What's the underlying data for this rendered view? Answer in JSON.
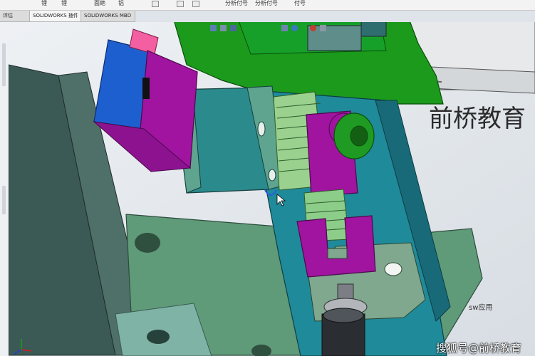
{
  "ribbon": {
    "labels": [
      "锂",
      "锂",
      "面絶",
      "铝",
      "分析付号",
      "分析付号",
      "付号"
    ]
  },
  "tabs": [
    {
      "label": "评估"
    },
    {
      "label": "SOLIDWORKS 插件"
    },
    {
      "label": "SOLIDWORKS MBD"
    }
  ],
  "watermark": {
    "brand": "前桥教育",
    "small_text": "sw应用",
    "footer": "搜狐号@前桥教育"
  },
  "colors": {
    "green": "#1c9a1c",
    "purple": "#9b169b",
    "teal": "#2f7f82",
    "blue": "#1b4fc8",
    "base_plate": "#5f9a79"
  },
  "icons": [
    "view-orientation-icon",
    "zoom-icon",
    "section-view-icon",
    "display-style-icon",
    "appearance-icon",
    "scene-icon",
    "triad-icon",
    "cursor-icon"
  ]
}
